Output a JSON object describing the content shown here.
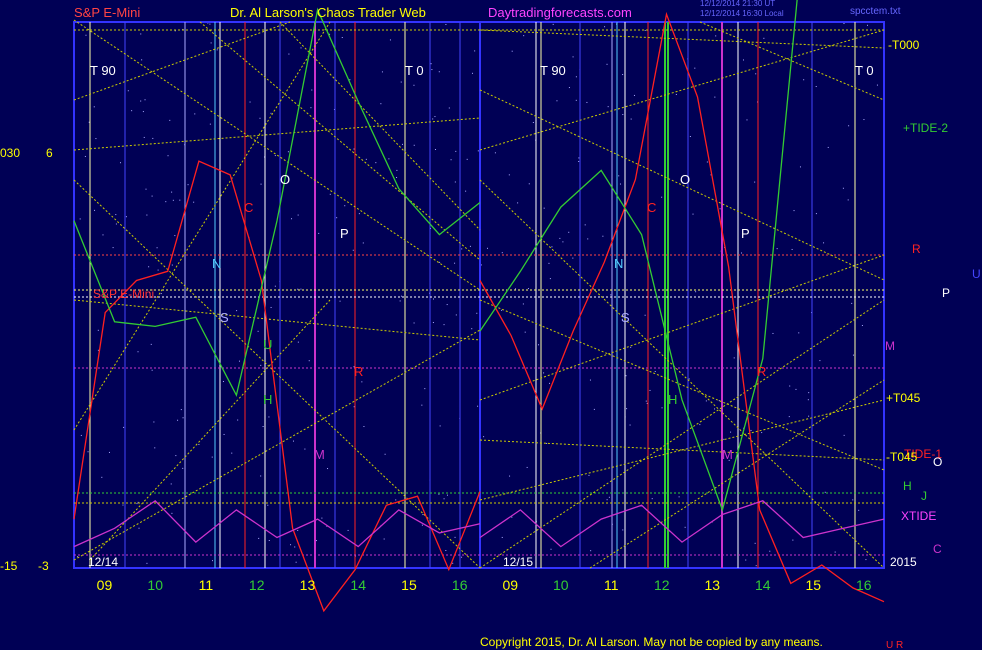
{
  "header": {
    "left": "S&P E-Mini",
    "center": "Dr. Al Larson's Chaos Trader Web",
    "site": "Daytradingforecasts.com",
    "time1": "12/12/2014 21:30 UT",
    "time2": "12/12/2014 16:30 Local",
    "file": "spcctem.txt"
  },
  "inner_left": "S&P E-Mini",
  "copyright": "Copyright 2015, Dr. Al Larson. May not be copied by any means.",
  "copyright_tail": "U R",
  "left_scale": {
    "top_a": "030",
    "top_b": "6",
    "bot_a": "-15",
    "bot_b": "-3"
  },
  "right_labels": {
    "t000": "-T000",
    "tide2": "+TIDE-2",
    "r": "R",
    "u": "U",
    "p": "P",
    "m": "M",
    "t045p": "+T045",
    "t045m": "-T045",
    "tide1": "TIDE-1",
    "o": "O",
    "h": "H",
    "j": "J",
    "xtide": "XTIDE",
    "c": "C",
    "year": "2015"
  },
  "panel1": {
    "date": "12/14",
    "t90": "T  90",
    "t0": "T  0"
  },
  "panel2": {
    "date": "12/15",
    "t90": "T  90",
    "t0": "T  0"
  },
  "colors": {
    "bg": "#000055",
    "frame": "#3333ff",
    "price": "#ff2020",
    "tide": "#33cc33",
    "xtide": "#cc33cc",
    "yellow": "#cccc00"
  },
  "chart_data": {
    "type": "line",
    "x_ticks_panel1": [
      "09",
      "10",
      "11",
      "12",
      "13",
      "14",
      "15",
      "16"
    ],
    "x_ticks_panel2": [
      "09",
      "10",
      "11",
      "12",
      "13",
      "14",
      "15",
      "16"
    ],
    "series": [
      {
        "name": "S&P E-Mini",
        "panel": 1,
        "values": [
          -2,
          2.5,
          3.2,
          3.4,
          5.8,
          5.5,
          3.2,
          -2.2,
          -4.0,
          -3.1,
          -1.7,
          -1.5,
          -3.1,
          -1.4
        ]
      },
      {
        "name": "S&P E-Mini",
        "panel": 2,
        "values": [
          3.2,
          2.0,
          0.4,
          2.1,
          3.6,
          5.4,
          9.0,
          7.2,
          3.5,
          -1.8,
          -3.4,
          -3.0,
          -3.5,
          -3.8
        ]
      },
      {
        "name": "+TIDE-2",
        "panel": 1,
        "values": [
          4.5,
          2.3,
          2.2,
          2.4,
          0.7,
          4.5,
          9.1,
          7.1,
          5.2,
          4.2,
          4.9
        ]
      },
      {
        "name": "+TIDE-2",
        "panel": 2,
        "values": [
          2.1,
          3.4,
          4.8,
          5.6,
          4.2,
          0.6,
          -1.8,
          1.5,
          10.7,
          11.2,
          11.0
        ]
      },
      {
        "name": "XTIDE",
        "panel": 1,
        "values": [
          -2.6,
          -2.2,
          -1.6,
          -2.5,
          -1.8,
          -2.4,
          -2.0,
          -2.6,
          -1.8,
          -2.3,
          -2.1
        ]
      },
      {
        "name": "XTIDE",
        "panel": 2,
        "values": [
          -2.4,
          -1.8,
          -2.6,
          -2.0,
          -1.7,
          -2.5,
          -1.9,
          -1.6,
          -2.4,
          -2.2,
          -2.0
        ]
      }
    ],
    "letters_panel1": [
      "N",
      "S",
      "U",
      "C",
      "O",
      "H",
      "P",
      "M",
      "R"
    ],
    "letters_panel2": [
      "N",
      "S",
      "C",
      "O",
      "H",
      "P",
      "M",
      "R"
    ]
  }
}
